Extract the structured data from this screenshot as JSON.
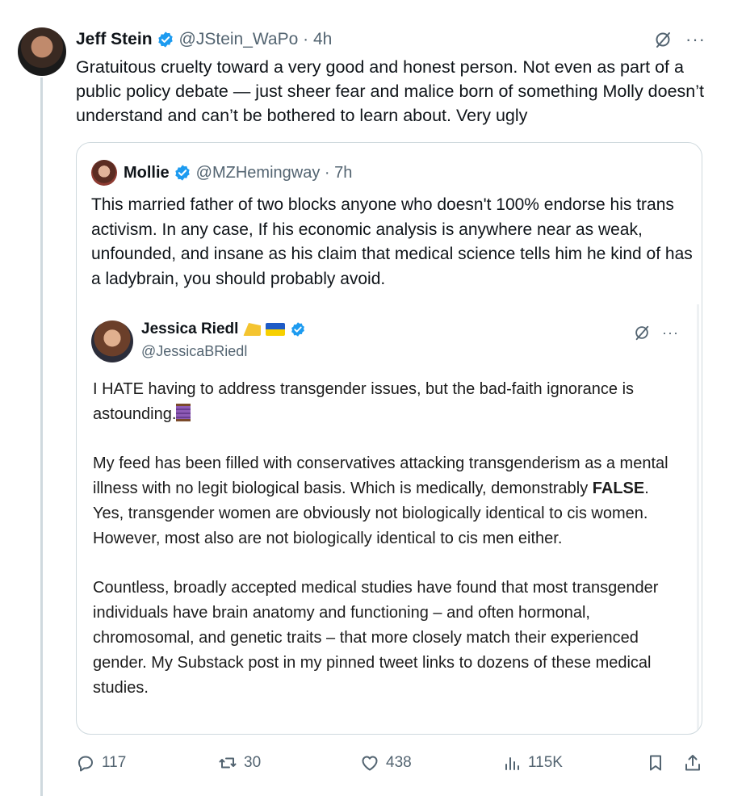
{
  "tweet": {
    "author": "Jeff Stein",
    "handle": "@JStein_WaPo",
    "time": "4h",
    "menu": "···",
    "text": "Gratuitous cruelty toward a very good and honest person. Not even as part of a public policy debate — just sheer fear and malice born of something Molly doesn’t understand and can’t be bothered to learn about. Very ugly"
  },
  "quote": {
    "author": "Mollie",
    "handle": "@MZHemingway",
    "time": "7h",
    "text": "This married father of two blocks anyone who doesn't 100% endorse his trans activism. In any case, If his economic analysis is anywhere near as weak, unfounded, and insane as his claim that medical science tells him he kind of has a ladybrain, you should probably avoid."
  },
  "embedded": {
    "author": "Jessica Riedl",
    "handle": "@JessicaBRiedl",
    "menu": "···",
    "p1": "I HATE having to address transgender issues, but the bad-faith ignorance is astounding.",
    "p2_a": "My feed has been filled with conservatives attacking transgenderism as a mental illness with no legit biological basis. Which is medically, demonstrably ",
    "p2_bold": "FALSE",
    "p2_b": ". Yes, transgender women are obviously not biologically identical to cis women. However, most also are not biologically identical to cis men either.",
    "p3": "Countless, broadly accepted medical studies have found that most transgender individuals have brain anatomy and functioning – and often hormonal, chromosomal, and genetic traits – that more closely match their experienced gender. My Substack post in my pinned tweet links to dozens of these medical studies."
  },
  "actions": {
    "replies": "117",
    "reposts": "30",
    "likes": "438",
    "views": "115K"
  },
  "colors": {
    "verified": "#1d9bf0",
    "muted": "#536471",
    "border": "#cfd9de"
  },
  "icons": [
    "verified-badge-icon",
    "grok-icon",
    "more-icon",
    "reply-icon",
    "repost-icon",
    "like-icon",
    "views-icon",
    "bookmark-icon",
    "share-icon",
    "cheese-emoji-icon",
    "ukraine-flag-icon",
    "spool-emoji-icon"
  ]
}
